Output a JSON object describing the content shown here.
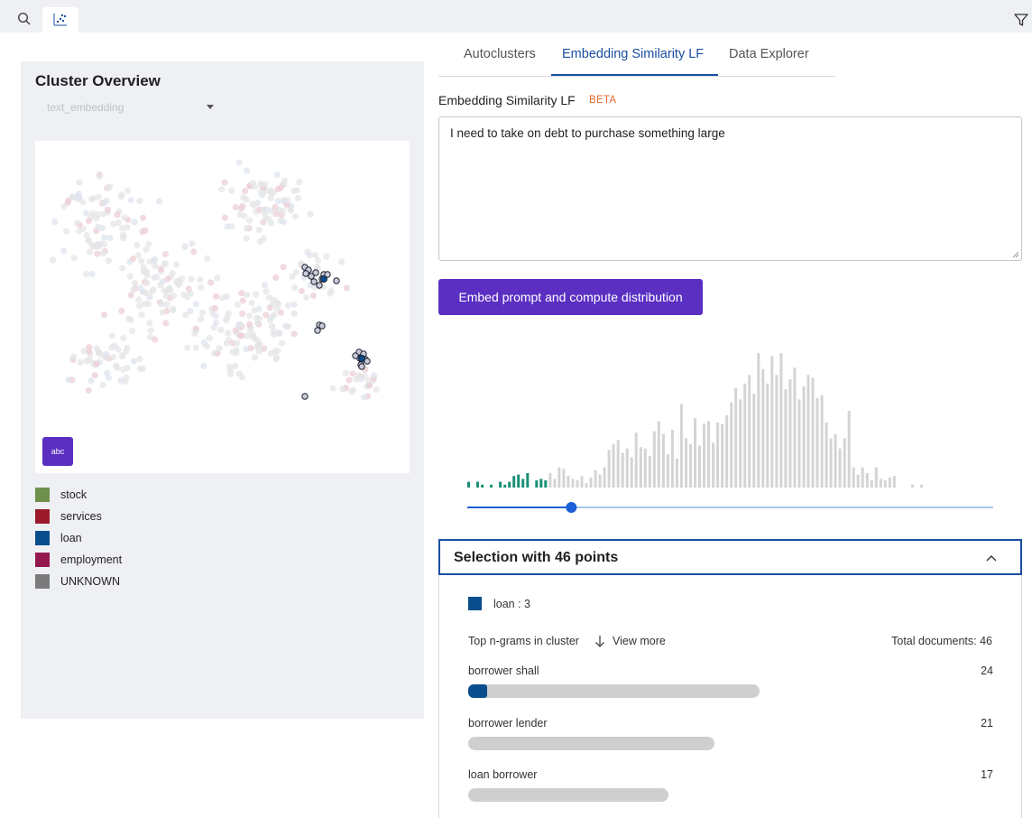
{
  "top": {
    "icons": [
      "search-icon",
      "scatter-icon",
      "filter-icon"
    ]
  },
  "cluster_overview": {
    "title": "Cluster Overview",
    "embedding_select": "text_embedding",
    "abc_label": "abc",
    "legend": [
      {
        "label": "stock",
        "color": "#6f8f4c"
      },
      {
        "label": "services",
        "color": "#9c1b2b"
      },
      {
        "label": "loan",
        "color": "#0a4d8c"
      },
      {
        "label": "employment",
        "color": "#961850"
      },
      {
        "label": "UNKNOWN",
        "color": "#7b7b7b"
      }
    ]
  },
  "tabs": [
    {
      "label": "Autoclusters",
      "active": false
    },
    {
      "label": "Embedding Similarity LF",
      "active": true
    },
    {
      "label": "Data Explorer",
      "active": false
    }
  ],
  "lf": {
    "title": "Embedding Similarity LF",
    "badge": "BETA",
    "prompt": "I need to take on debt to purchase something large",
    "button": "Embed prompt and compute distribution"
  },
  "histogram": {
    "selected_color": "#1a9077",
    "unselected_color": "#d4d4d4",
    "slider_color": "#1a5fd8",
    "threshold_bin": 17,
    "relative_heights": [
      0.04,
      0.0,
      0.04,
      0.02,
      0.0,
      0.02,
      0.0,
      0.04,
      0.02,
      0.04,
      0.08,
      0.09,
      0.06,
      0.1,
      0.0,
      0.05,
      0.06,
      0.05,
      0.1,
      0.06,
      0.14,
      0.13,
      0.08,
      0.06,
      0.05,
      0.08,
      0.03,
      0.07,
      0.12,
      0.09,
      0.14,
      0.26,
      0.3,
      0.33,
      0.24,
      0.27,
      0.21,
      0.38,
      0.28,
      0.27,
      0.22,
      0.39,
      0.46,
      0.37,
      0.23,
      0.4,
      0.2,
      0.58,
      0.34,
      0.3,
      0.48,
      0.29,
      0.44,
      0.46,
      0.31,
      0.45,
      0.44,
      0.5,
      0.59,
      0.69,
      0.61,
      0.72,
      0.78,
      0.65,
      0.93,
      0.82,
      0.72,
      0.91,
      0.78,
      0.93,
      0.68,
      0.75,
      0.83,
      0.61,
      0.7,
      0.78,
      0.76,
      0.62,
      0.64,
      0.45,
      0.34,
      0.37,
      0.27,
      0.34,
      0.53,
      0.14,
      0.09,
      0.14,
      0.1,
      0.05,
      0.14,
      0.06,
      0.05,
      0.07,
      0.08,
      0.0,
      0.0,
      0.0,
      0.02,
      0.0,
      0.02
    ]
  },
  "selection": {
    "title": "Selection with 46 points",
    "loan_label": "loan : 3",
    "ngram_header": "Top n-grams in cluster",
    "view_more": "View more",
    "total_docs": "Total documents: 46",
    "ngrams": [
      {
        "label": "borrower shall",
        "count": "24",
        "fraction": 0.555,
        "loan_fraction": 0.036
      },
      {
        "label": "borrower lender",
        "count": "21",
        "fraction": 0.469
      },
      {
        "label": "loan borrower",
        "count": "17",
        "fraction": 0.381
      }
    ]
  }
}
